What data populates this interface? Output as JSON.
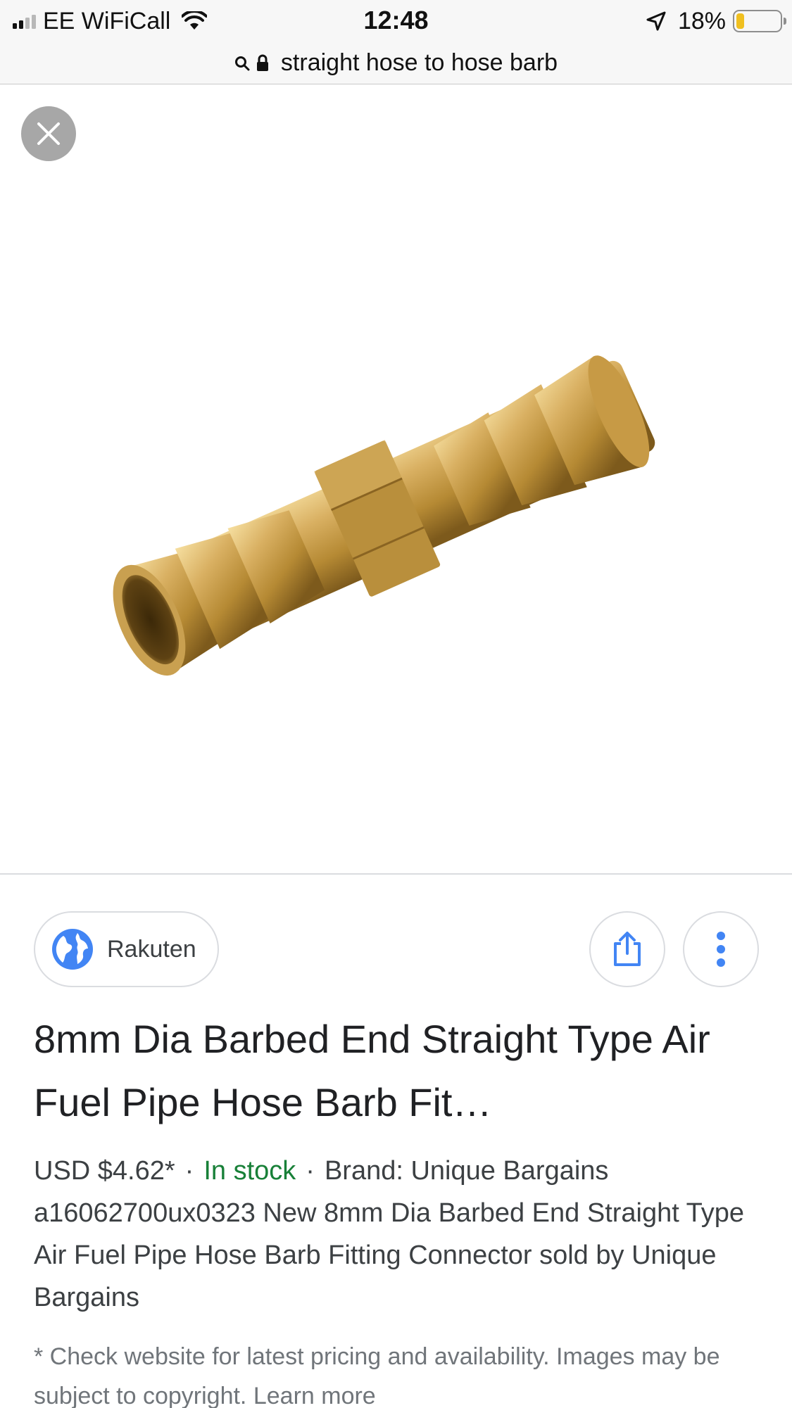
{
  "status_bar": {
    "carrier": "EE WiFiCall",
    "time": "12:48",
    "battery_percent": "18%",
    "battery_level": 0.18,
    "signal_bars_on": 2,
    "signal_bars_total": 4,
    "icons": [
      "signal-icon",
      "wifi-icon",
      "location-arrow-icon",
      "battery-icon"
    ]
  },
  "url_bar": {
    "query": "straight hose to hose barb",
    "icons": [
      "search-icon",
      "lock-icon"
    ]
  },
  "image_viewer": {
    "close_icon": "close-icon",
    "product_image_icon": "brass-hose-barb-image"
  },
  "source": {
    "label": "Rakuten",
    "icon": "globe-icon"
  },
  "actions": {
    "share_icon": "share-icon",
    "more_icon": "more-vertical-icon"
  },
  "product": {
    "title": "8mm Dia Barbed End Straight Type Air Fuel Pipe Hose Barb Fit…",
    "price": "USD $4.62*",
    "separator": "·",
    "stock": "In stock",
    "brand": "Brand: Unique Bargains",
    "description": "a16062700ux0323 New 8mm Dia Barbed End Straight Type Air Fuel Pipe Hose Barb Fitting Connector sold by Unique Bargains"
  },
  "disclaimer": {
    "text": "* Check website for latest pricing and availability. Images may be subject to copyright.",
    "link": "Learn more"
  },
  "colors": {
    "in_stock": "#188038",
    "accent_blue": "#4285f4",
    "battery_fill": "#f0c020",
    "close_bg": "#a7a7a7"
  }
}
